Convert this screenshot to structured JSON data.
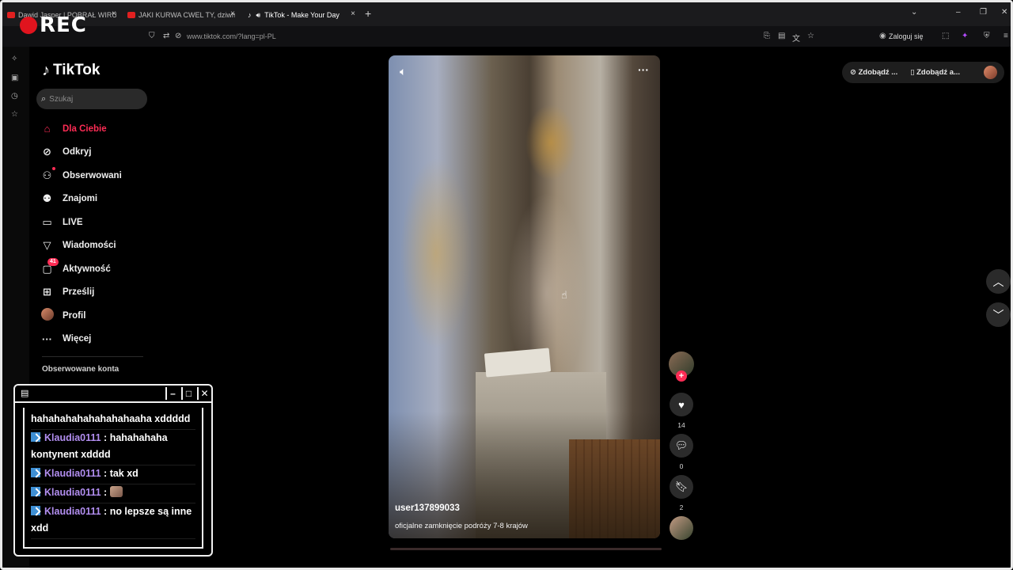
{
  "browser": {
    "tabs": [
      {
        "title": "Dawid Jasper | POBRAŁ WIRUSA",
        "active": false
      },
      {
        "title": "JAKI KURWA CWEL TY, dziwna",
        "active": false
      },
      {
        "title": "TikTok - Make Your Day",
        "active": true
      }
    ],
    "url": "www.tiktok.com/?lang=pl-PL",
    "login_label": "Zaloguj się"
  },
  "overlay": {
    "rec_label": "REC"
  },
  "tiktok": {
    "brand": "TikTok",
    "search_placeholder": "Szukaj",
    "menu": [
      {
        "label": "Dla Ciebie",
        "icon": "home-icon",
        "active": true
      },
      {
        "label": "Odkryj",
        "icon": "compass-icon"
      },
      {
        "label": "Obserwowani",
        "icon": "user-follow-icon"
      },
      {
        "label": "Znajomi",
        "icon": "friends-icon"
      },
      {
        "label": "LIVE",
        "icon": "live-tv-icon"
      },
      {
        "label": "Wiadomości",
        "icon": "send-icon"
      },
      {
        "label": "Aktywność",
        "icon": "inbox-icon",
        "badge": "41"
      },
      {
        "label": "Prześlij",
        "icon": "upload-plus-icon"
      },
      {
        "label": "Profil",
        "icon": "profile-avatar"
      },
      {
        "label": "Więcej",
        "icon": "more-dots-icon"
      }
    ],
    "followed_heading": "Obserwowane konta",
    "top_right": {
      "get_coins": "Zdobądź ...",
      "get_app": "Zdobądź a..."
    },
    "video": {
      "author": "user137899033",
      "description": "oficjalne zamknięcie podróży 7-8 krajów",
      "likes": "14",
      "comments": "0",
      "saves": "2"
    }
  },
  "chat": {
    "messages": [
      {
        "user": "",
        "text": "hahahahahahahahahaaha xddddd"
      },
      {
        "user": "Klaudia0111",
        "text": "hahahahaha kontynent xdddd"
      },
      {
        "user": "Klaudia0111",
        "text": "tak xd"
      },
      {
        "user": "Klaudia0111",
        "text": ""
      },
      {
        "user": "Klaudia0111",
        "text": "no lepsze są inne xdd"
      }
    ]
  },
  "colors": {
    "accent": "#fe2c55",
    "chat_user": "#b28ef0",
    "rec": "#e0141e"
  }
}
